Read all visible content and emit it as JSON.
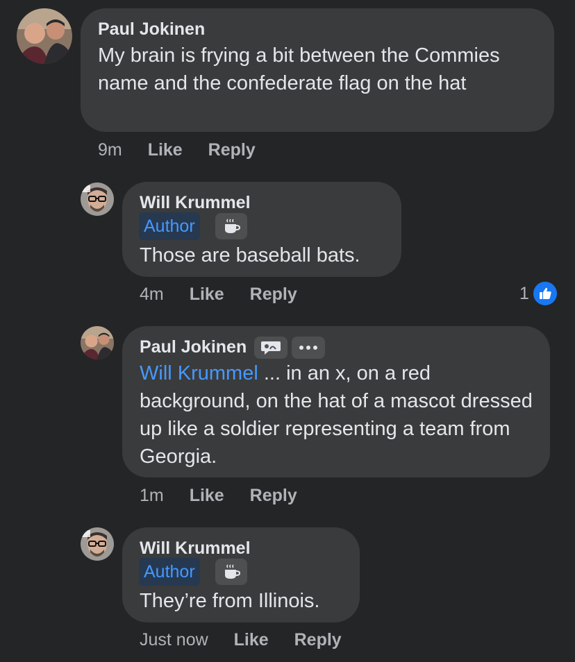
{
  "comments": [
    {
      "author": "Paul Jokinen",
      "text": "My brain is frying a bit between the Commies name and the confederate flag on the hat",
      "time": "9m",
      "like_label": "Like",
      "reply_label": "Reply",
      "avatar": "two-people-avatar"
    },
    {
      "author": "Will Krummel",
      "badge": "Author",
      "badge_icon": "coffee-icon",
      "text": "Those are baseball bats.",
      "time": "4m",
      "like_label": "Like",
      "reply_label": "Reply",
      "reaction_count": "1",
      "reaction_icon": "thumbs-up-icon",
      "avatar": "glasses-man-avatar"
    },
    {
      "author": "Paul Jokinen",
      "mention": "Will Krummel",
      "text": " ... in an x, on a red background, on the hat of a mascot dressed up like a soldier representing a team from Georgia.",
      "time": "1m",
      "like_label": "Like",
      "reply_label": "Reply",
      "avatar": "two-people-avatar",
      "badge_icon": "speech-bubble-icon",
      "more_icon": "more-options-icon"
    },
    {
      "author": "Will Krummel",
      "badge": "Author",
      "badge_icon": "coffee-icon",
      "text": "They’re from Illinois.",
      "time": "Just now",
      "like_label": "Like",
      "reply_label": "Reply",
      "avatar": "glasses-man-avatar"
    }
  ],
  "colors": {
    "background": "#242526",
    "bubble": "#3a3b3c",
    "mention": "#4599ff",
    "author_badge_bg": "#263951",
    "meta_text": "#b0b3b8",
    "like_blue": "#1877f2"
  }
}
